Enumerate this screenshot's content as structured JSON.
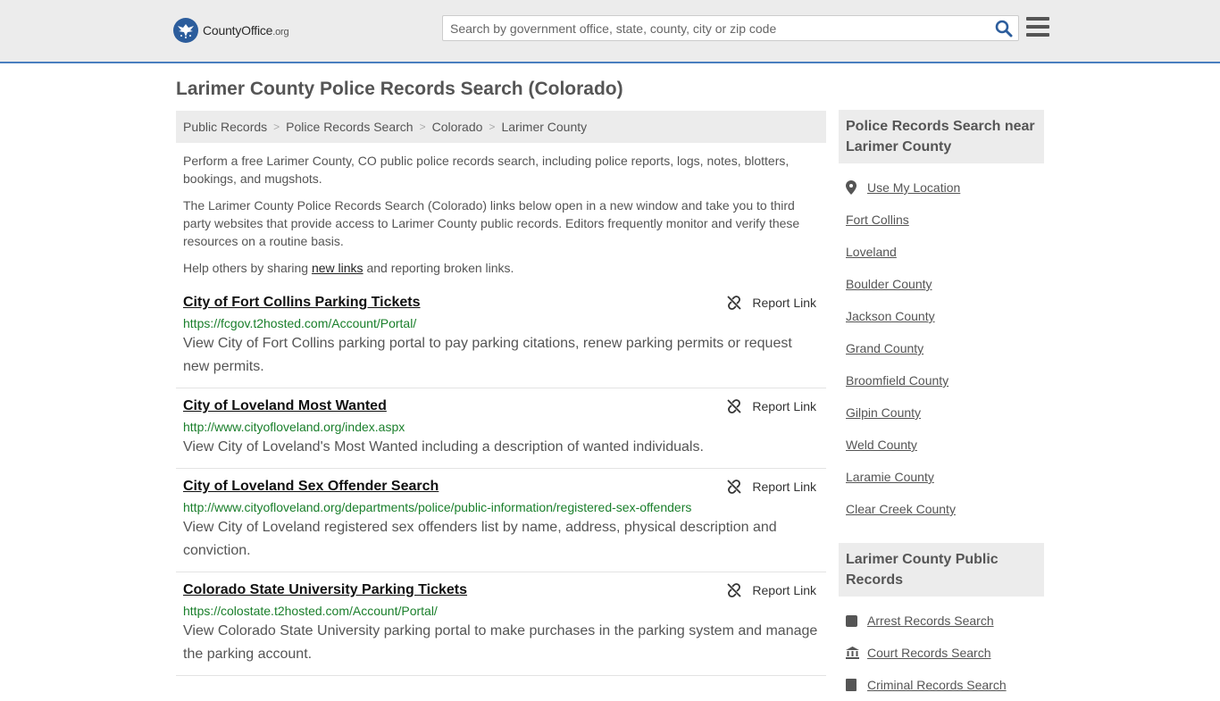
{
  "header": {
    "logo_main": "CountyOffice",
    "logo_tld": ".org",
    "search_placeholder": "Search by government office, state, county, city or zip code"
  },
  "page": {
    "title": "Larimer County Police Records Search (Colorado)"
  },
  "breadcrumb": [
    "Public Records",
    "Police Records Search",
    "Colorado",
    "Larimer County"
  ],
  "intro": {
    "p1": "Perform a free Larimer County, CO public police records search, including police reports, logs, notes, blotters, bookings, and mugshots.",
    "p2": "The Larimer County Police Records Search (Colorado) links below open in a new window and take you to third party websites that provide access to Larimer County public records. Editors frequently monitor and verify these resources on a routine basis.",
    "p3_before": "Help others by sharing ",
    "p3_link": "new links",
    "p3_after": " and reporting broken links."
  },
  "report_label": "Report Link",
  "results": [
    {
      "title": "City of Fort Collins Parking Tickets",
      "url": "https://fcgov.t2hosted.com/Account/Portal/",
      "desc": "View City of Fort Collins parking portal to pay parking citations, renew parking permits or request new permits."
    },
    {
      "title": "City of Loveland Most Wanted",
      "url": "http://www.cityofloveland.org/index.aspx",
      "desc": "View City of Loveland's Most Wanted including a description of wanted individuals."
    },
    {
      "title": "City of Loveland Sex Offender Search",
      "url": "http://www.cityofloveland.org/departments/police/public-information/registered-sex-offenders",
      "desc": "View City of Loveland registered sex offenders list by name, address, physical description and conviction."
    },
    {
      "title": "Colorado State University Parking Tickets",
      "url": "https://colostate.t2hosted.com/Account/Portal/",
      "desc": "View Colorado State University parking portal to make purchases in the parking system and manage the parking account."
    }
  ],
  "sidebar": {
    "near_title": "Police Records Search near Larimer County",
    "use_location": "Use My Location",
    "near_items": [
      "Fort Collins",
      "Loveland",
      "Boulder County",
      "Jackson County",
      "Grand County",
      "Broomfield County",
      "Gilpin County",
      "Weld County",
      "Laramie County",
      "Clear Creek County"
    ],
    "public_title": "Larimer County Public Records",
    "public_items": [
      {
        "label": "Arrest Records Search",
        "icon": "square-icon"
      },
      {
        "label": "Court Records Search",
        "icon": "courthouse-icon"
      },
      {
        "label": "Criminal Records Search",
        "icon": "document-icon"
      }
    ]
  },
  "colors": {
    "link_green": "#1a7f2b",
    "accent_blue": "#4a7fbf",
    "logo_blue": "#2c5d9c",
    "panel_gray": "#ececec"
  }
}
